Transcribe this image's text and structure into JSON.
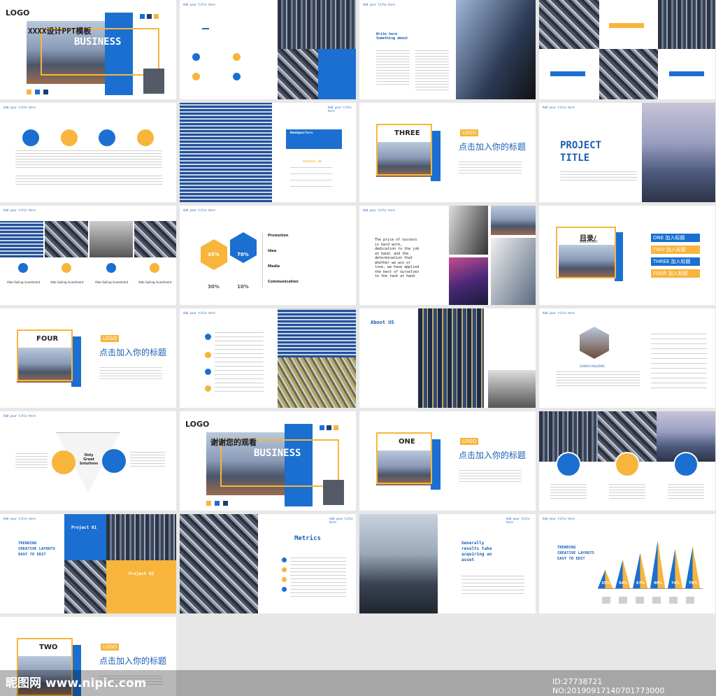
{
  "header_tag": "Add your title here",
  "cover": {
    "logo": "LOGO",
    "title_cn": "XXXX设计PPT模板",
    "title_en": "BUSINESS"
  },
  "thanks": {
    "logo": "LOGO",
    "title_cn": "谢谢您的观看",
    "title_en": "BUSINESS"
  },
  "write_here": "Write here Something about",
  "project_title": "PROJECT TITLE",
  "headquarters": "Headquarters",
  "contact": "Contact US",
  "quote": "The price of success is hard work, dedication to the job at hand, and the determination that whether we win or lose, we have applied the best of ourselves to the task at hand",
  "directory": {
    "title": "目录/",
    "sub": "DIRECTORY",
    "items": [
      "ONE 加入标题",
      "TWO 加入标题",
      "THREE 加入标题",
      "FOUR 加入标题"
    ]
  },
  "sections": [
    {
      "num": "THREE",
      "logo": "LOGO",
      "title": "点击加入你的标题"
    },
    {
      "num": "FOUR",
      "logo": "LOGO",
      "title": "点击加入你的标题"
    },
    {
      "num": "ONE",
      "logo": "LOGO",
      "title": "点击加入你的标题"
    },
    {
      "num": "TWO",
      "logo": "LOGO",
      "title": "点击加入你的标题"
    }
  ],
  "percent": {
    "values": [
      "45%",
      "70%",
      "30%",
      "10%"
    ],
    "labels": [
      "Promotion",
      "Idea",
      "Media",
      "Communication"
    ]
  },
  "about": "About US",
  "only_great": "Only Great Solutions",
  "trending": "TRENDING CREATIVE LAYOUTS EASY TO EDIT",
  "project01": "Project 01",
  "project02": "Project 02",
  "metrics": "Metrics",
  "generally": "Generally results take acquiring an asset",
  "bars": {
    "values": [
      "35%",
      "54%",
      "67%",
      "90%",
      "74%",
      "79%"
    ]
  },
  "four_caption": "Aide Sailing investment",
  "hexagon_caption": "GUNGA HALLOWS",
  "watermark": {
    "left": "昵图网 www.nipic.com",
    "right": "ID:27738721 NO:20190917140701773000"
  },
  "colors": {
    "blue": "#1a6fd1",
    "yellow": "#f8b53b"
  }
}
